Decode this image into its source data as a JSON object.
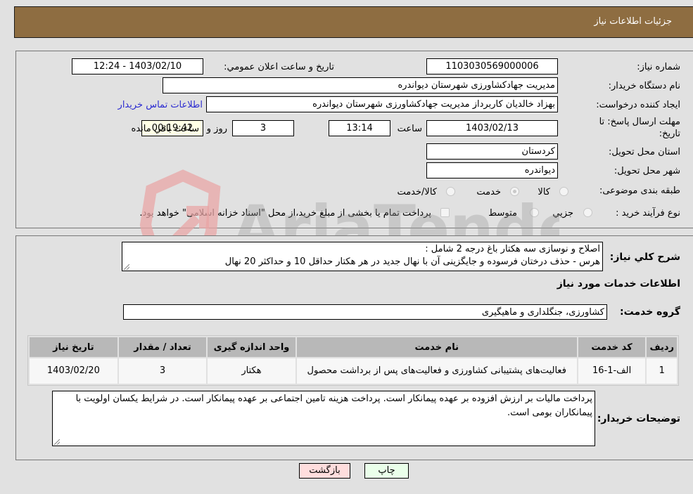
{
  "header": {
    "title": "جزئیات اطلاعات نیاز"
  },
  "details": {
    "need_number": {
      "label": "شماره نیاز:",
      "value": "1103030569000006"
    },
    "announce_datetime": {
      "label": "تاریخ و ساعت اعلان عمومي:",
      "value": "1403/02/10 - 12:24"
    },
    "buyer_org": {
      "label": "نام دستگاه خريدار:",
      "value": "مدیریت جهادکشاورزی شهرستان دیواندره"
    },
    "requester": {
      "label": "ايجاد کننده درخواست:",
      "value": "بهزاد خالدیان کاربرداز مدیریت جهادکشاورزی شهرستان دیواندره"
    },
    "buyer_contact_link": "اطلاعات تماس خريدار",
    "deadline": {
      "label_line1": "مهلت ارسال پاسخ: تا",
      "label_line2": "تاریخ:",
      "date": "1403/02/13",
      "time_label": "ساعت",
      "time": "13:14",
      "days": "3",
      "days_label": "روز و",
      "remaining": "00:19:42",
      "remaining_label": "ساعت باقي مانده"
    },
    "province": {
      "label": "استان محل تحويل:",
      "value": "کردستان"
    },
    "city": {
      "label": "شهر محل تحويل:",
      "value": "دیواندره"
    },
    "category": {
      "label": "طبقه بندی موضوعی:",
      "options": [
        "کالا",
        "خدمت",
        "کالا/خدمت"
      ],
      "selected": "خدمت"
    },
    "purchase_type": {
      "label": "نوع فرآیند خرید :",
      "options": [
        "جزيي",
        "متوسط"
      ],
      "selected": "جزيي",
      "treasury_note": "پرداخت تمام یا بخشی از مبلغ خرید،از محل \"اسناد خزانه اسلامی\" خواهد بود."
    }
  },
  "description": {
    "label": "شرح کلي نياز:",
    "line1": "اصلاح و نوسازی سه هکتار باغ درجه 2 شامل :",
    "line2": "هرس - حذف درختان فرسوده و جایگزینی آن با نهال جدید در هر هکتار حداقل 10 و حداکثر 20 نهال"
  },
  "services": {
    "section_title": "اطلاعات خدمات مورد نياز",
    "group_label": "گروه خدمت:",
    "group_value": "کشاورزی، جنگلداری و ماهیگیری",
    "table": {
      "headers": [
        "رديف",
        "کد خدمت",
        "نام خدمت",
        "واحد اندازه گيری",
        "تعداد / مقدار",
        "تاريخ نياز"
      ],
      "rows": [
        [
          "1",
          "الف-1-16",
          "فعالیت‌های پشتیبانی کشاورزی و فعالیت‌های پس از برداشت محصول",
          "هکتار",
          "3",
          "1403/02/20"
        ]
      ]
    }
  },
  "buyer_notes": {
    "label": "توضيحات خريدار:",
    "text": "پرداخت مالیات بر ارزش افزوده بر عهده پیمانکار است. پرداخت هزینه تامین اجتماعی بر عهده پیمانکار است. در شرایط یکسان اولویت با پیمانکاران بومی است."
  },
  "buttons": {
    "print": "چاپ",
    "back": "بازگشت"
  },
  "watermark": {
    "text": "AriaTender.net"
  },
  "colors": {
    "header_bg": "#8e6d41",
    "back_btn": "#ffdddd",
    "print_btn": "#eaffea",
    "link": "#2b2bd1"
  }
}
